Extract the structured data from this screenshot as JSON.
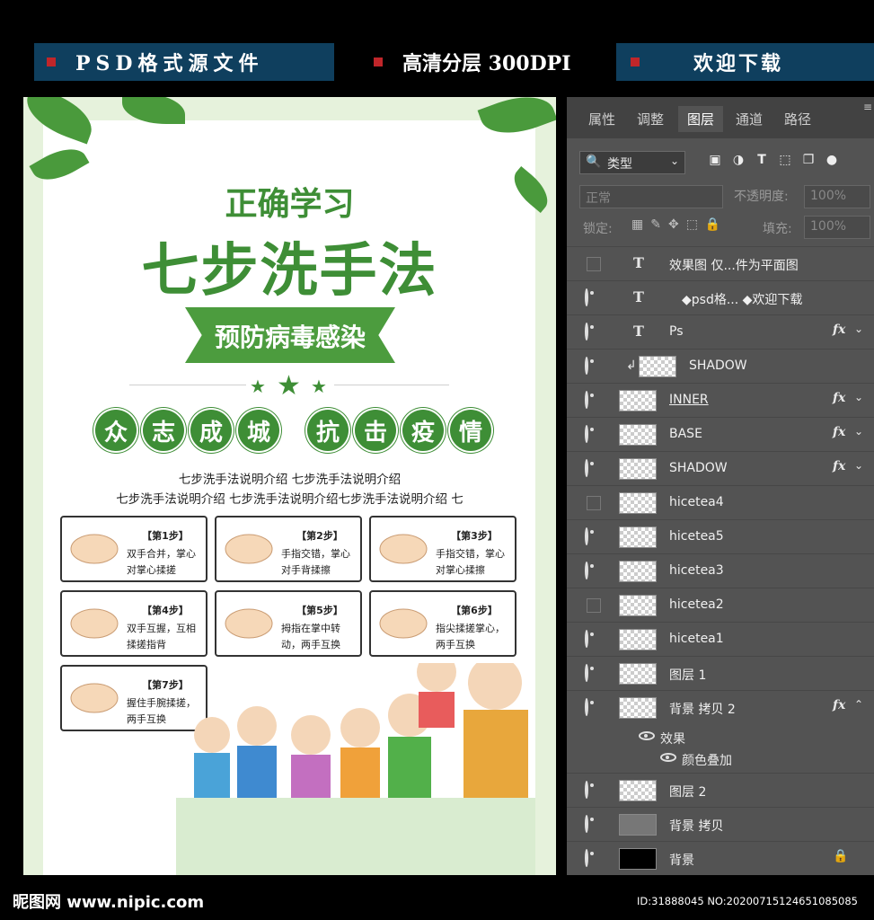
{
  "banner": {
    "b1": "PSD格式源文件",
    "b2": "高清分层 300DPI",
    "b3": "欢迎下载"
  },
  "poster": {
    "subtitle": "正确学习",
    "title": "七步洗手法",
    "ribbon": "预防病毒感染",
    "circles": [
      "众",
      "志",
      "成",
      "城",
      "抗",
      "击",
      "疫",
      "情"
    ],
    "desc1": "七步洗手法说明介绍 七步洗手法说明介绍",
    "desc2": "七步洗手法说明介绍 七步洗手法说明介绍七步洗手法说明介绍 七",
    "steps": [
      {
        "num": "【第1步】",
        "line1": "双手合并，掌心",
        "line2": "对掌心揉搓"
      },
      {
        "num": "【第2步】",
        "line1": "手指交错，掌心",
        "line2": "对手背揉擦"
      },
      {
        "num": "【第3步】",
        "line1": "手指交错，掌心",
        "line2": "对掌心揉擦"
      },
      {
        "num": "【第4步】",
        "line1": "双手互握，互相",
        "line2": "揉搓指背"
      },
      {
        "num": "【第5步】",
        "line1": "拇指在掌中转",
        "line2": "动，两手互换"
      },
      {
        "num": "【第6步】",
        "line1": "指尖揉搓掌心，",
        "line2": "两手互换"
      },
      {
        "num": "【第7步】",
        "line1": "握住手腕揉搓，",
        "line2": "两手互换"
      }
    ]
  },
  "ps": {
    "tabs": [
      "属性",
      "调整",
      "图层",
      "通道",
      "路径"
    ],
    "active_tab": "图层",
    "filter": "类型",
    "blend_mode": "正常",
    "opacity_label": "不透明度:",
    "opacity_value": "100%",
    "lock_label": "锁定:",
    "fill_label": "填充:",
    "fill_value": "100%",
    "layers": [
      {
        "name": "效果图 仅...件为平面图",
        "type": "text",
        "visible": false,
        "fx": false
      },
      {
        "name": "◆psd格... ◆欢迎下载",
        "type": "text",
        "visible": true,
        "fx": false
      },
      {
        "name": "Ps",
        "type": "text",
        "visible": true,
        "fx": true
      },
      {
        "name": "SHADOW",
        "type": "clip",
        "visible": true,
        "fx": false
      },
      {
        "name": "INNER",
        "type": "smart",
        "visible": true,
        "fx": true
      },
      {
        "name": "BASE",
        "type": "smart",
        "visible": true,
        "fx": true
      },
      {
        "name": "SHADOW",
        "type": "pixel",
        "visible": true,
        "fx": true
      },
      {
        "name": "hicetea4",
        "type": "pixel",
        "visible": false,
        "fx": false
      },
      {
        "name": "hicetea5",
        "type": "pixel",
        "visible": true,
        "fx": false
      },
      {
        "name": "hicetea3",
        "type": "pixel",
        "visible": true,
        "fx": false
      },
      {
        "name": "hicetea2",
        "type": "pixel",
        "visible": false,
        "fx": false
      },
      {
        "name": "hicetea1",
        "type": "pixel",
        "visible": true,
        "fx": false
      },
      {
        "name": "图层 1",
        "type": "pixel",
        "visible": true,
        "fx": false
      },
      {
        "name": "背景 拷贝 2",
        "type": "pixel",
        "visible": true,
        "fx": true
      }
    ],
    "effects_label": "效果",
    "effect_item": "颜色叠加",
    "bottom_layers": [
      {
        "name": "图层 2",
        "type": "pixel",
        "visible": true
      },
      {
        "name": "背景 拷贝",
        "type": "gray",
        "visible": true
      },
      {
        "name": "背景",
        "type": "black",
        "visible": true
      }
    ]
  },
  "footer": {
    "logo": "昵图网 www.nipic.com",
    "id": "ID:31888045 NO:20200715124651085085"
  },
  "colors": {
    "green": "#3e8e36",
    "banner": "#0f3f5e",
    "ps_bg": "#535353"
  }
}
